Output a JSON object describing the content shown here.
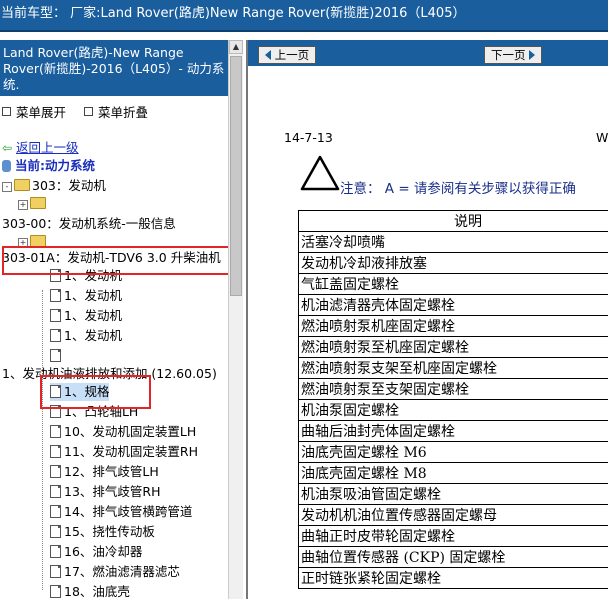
{
  "header": {
    "title": "当前车型： 厂家:Land Rover(路虎)New Range Rover(新揽胜)2016（L405）"
  },
  "left": {
    "title": "Land Rover(路虎)-New Range Rover(新揽胜)-2016（L405）- 动力系统.",
    "menu_expand": "菜单展开",
    "menu_collapse": "菜单折叠",
    "back": "返回上一级",
    "current": "当前:动力系统",
    "tree": [
      {
        "label": "303：发动机"
      },
      {
        "label": ""
      },
      {
        "label": "303-00：发动机系统-一般信息"
      },
      {
        "label": ""
      },
      {
        "label": "303-01A：发动机-TDV6 3.0 升柴油机"
      },
      {
        "label": "1、发动机"
      },
      {
        "label": "1、发动机"
      },
      {
        "label": "1、发动机"
      },
      {
        "label": "1、发动机"
      },
      {
        "label": ""
      },
      {
        "label": "1、发动机油液排放和添加 (12.60.05)"
      },
      {
        "label": "1、规格"
      },
      {
        "label": "1、凸轮轴LH"
      },
      {
        "label": "10、发动机固定装置LH"
      },
      {
        "label": "11、发动机固定装置RH"
      },
      {
        "label": "12、排气歧管LH"
      },
      {
        "label": "13、排气歧管RH"
      },
      {
        "label": "14、排气歧管横跨管道"
      },
      {
        "label": "15、挠性传动板"
      },
      {
        "label": "16、油冷却器"
      },
      {
        "label": "17、燃油滤清器滤芯"
      },
      {
        "label": "18、油底壳"
      }
    ]
  },
  "nav": {
    "prev": "上一页",
    "next": "下一页"
  },
  "doc": {
    "date": "14-7-13",
    "page_ref": "W",
    "note": "注意：  A = 请参阅有关步骤以获得正确",
    "table_header": "说明",
    "rows": [
      "活塞冷却喷嘴",
      "发动机冷却液排放塞",
      "气缸盖固定螺栓",
      "机油滤清器壳体固定螺栓",
      "燃油喷射泵机座固定螺栓",
      "燃油喷射泵至机座固定螺栓",
      "燃油喷射泵支架至机座固定螺栓",
      "燃油喷射泵至支架固定螺栓",
      "机油泵固定螺栓",
      "曲轴后油封壳体固定螺栓",
      "油底壳固定螺栓 M6",
      "油底壳固定螺栓 M8",
      "机油泵吸油管固定螺栓",
      "发动机机油位置传感器固定螺母",
      "曲轴正时皮带轮固定螺栓",
      "曲轴位置传感器 (CKP) 固定螺栓",
      "正时链张紧轮固定螺栓"
    ]
  },
  "colors": {
    "header_bg": "#1a5e9e",
    "highlight_box": "#e02626",
    "link": "#1a2fbb"
  }
}
